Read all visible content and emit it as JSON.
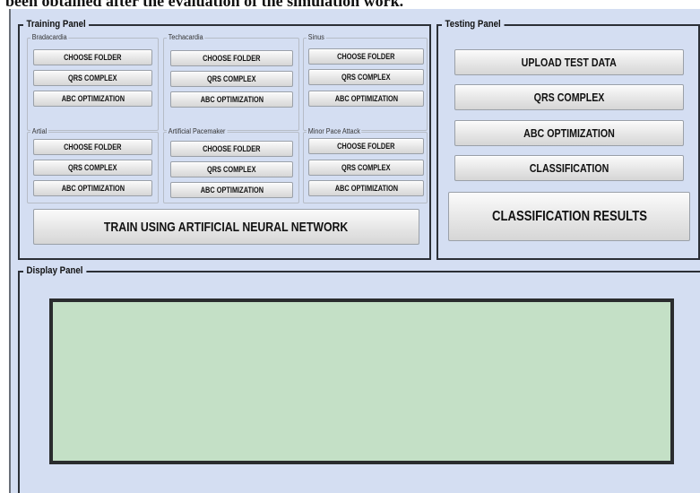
{
  "caption": "been obtained after the evaluation of the simulation work.",
  "training_panel": {
    "title": "Training Panel",
    "groups": [
      {
        "title": "Bradacardia",
        "choose": "CHOOSE FOLDER",
        "qrs": "QRS COMPLEX",
        "abc": "ABC OPTIMIZATION"
      },
      {
        "title": "Techacardia",
        "choose": "CHOOSE FOLDER",
        "qrs": "QRS COMPLEX",
        "abc": "ABC OPTIMIZATION"
      },
      {
        "title": "Sinus",
        "choose": "CHOOSE FOLDER",
        "qrs": "QRS COMPLEX",
        "abc": "ABC OPTIMIZATION"
      },
      {
        "title": "Artial",
        "choose": "CHOOSE FOLDER",
        "qrs": "QRS COMPLEX",
        "abc": "ABC OPTIMIZATION"
      },
      {
        "title": "Artificial Pacemaker",
        "choose": "CHOOSE FOLDER",
        "qrs": "QRS COMPLEX",
        "abc": "ABC OPTIMIZATION"
      },
      {
        "title": "Minor Pace Attack",
        "choose": "CHOOSE FOLDER",
        "qrs": "QRS COMPLEX",
        "abc": "ABC OPTIMIZATION"
      }
    ],
    "train_button": "TRAIN USING ARTIFICIAL NEURAL NETWORK"
  },
  "testing_panel": {
    "title": "Testing Panel",
    "upload": "UPLOAD TEST DATA",
    "qrs": "QRS COMPLEX",
    "abc": "ABC OPTIMIZATION",
    "classification": "CLASSIFICATION",
    "results": "CLASSIFICATION RESULTS"
  },
  "display_panel": {
    "title": "Display Panel"
  }
}
